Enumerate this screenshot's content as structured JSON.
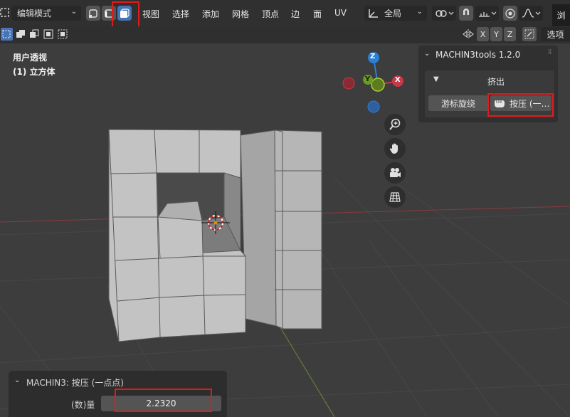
{
  "header": {
    "mode_label": "编辑模式",
    "menus": [
      "视图",
      "选择",
      "添加",
      "网格",
      "顶点",
      "边",
      "面",
      "UV"
    ],
    "transform_orientation": "全局",
    "top_right_partial": "浏"
  },
  "toolbar2": {
    "axes": [
      "X",
      "Y",
      "Z"
    ],
    "options_label": "选项"
  },
  "viewport": {
    "view_name": "用户透视",
    "object_name": "(1) 立方体"
  },
  "gizmo": {
    "z": "Z",
    "y": "Y",
    "x": "X"
  },
  "npanel": {
    "title": "MACHIN3tools 1.2.0",
    "section": "挤出",
    "btn_cursor_spin": "游标旋绕",
    "btn_punch": "按压 (一…"
  },
  "operator": {
    "title": "MACHIN3: 按压 (一点点)",
    "amount_label": "(数)量",
    "amount_value": "2.2320"
  },
  "colors": {
    "accent_blue": "#4772b3",
    "highlight_red": "#e01b1b",
    "x_axis": "#c8374a",
    "y_axis": "#6a9a1f",
    "z_axis": "#2a7fd6"
  }
}
